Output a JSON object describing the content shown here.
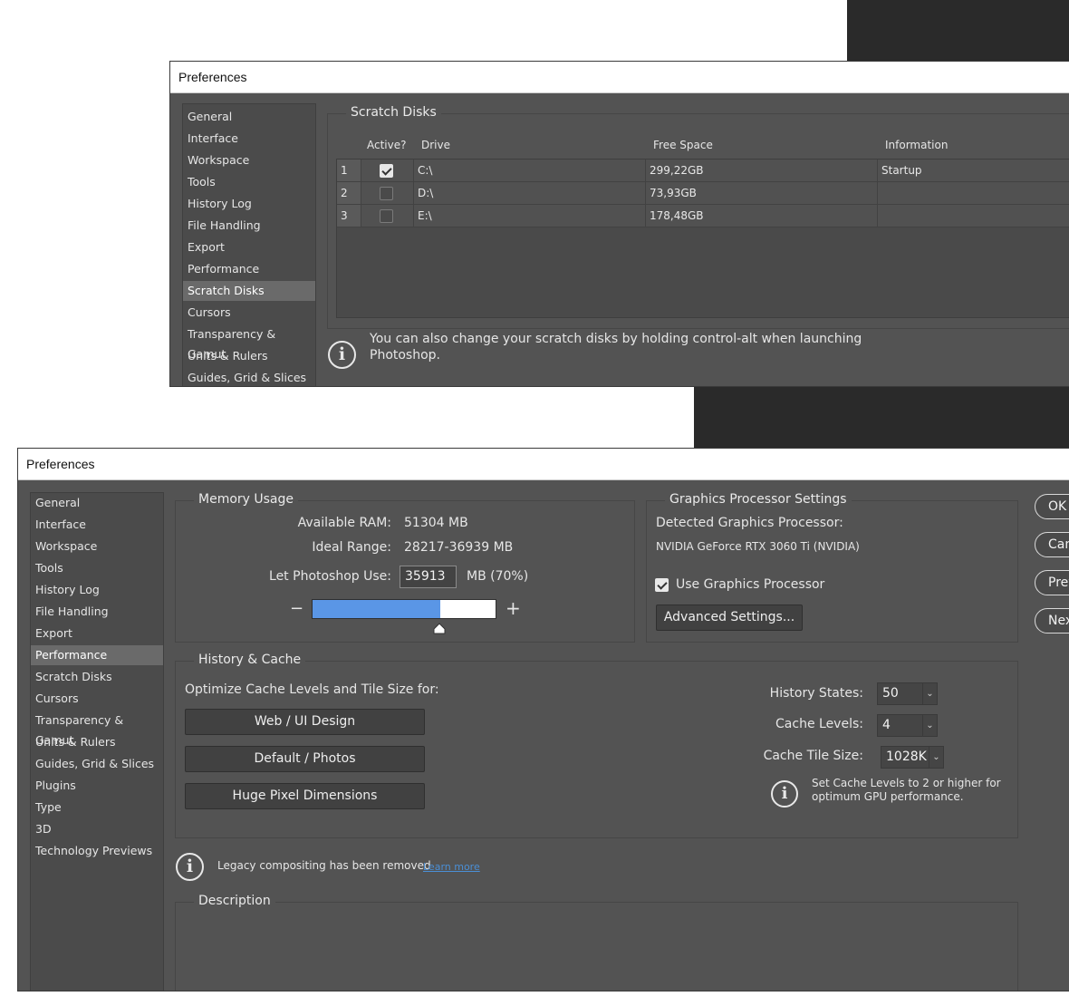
{
  "top": {
    "title": "Preferences",
    "sidebar": [
      "General",
      "Interface",
      "Workspace",
      "Tools",
      "History Log",
      "File Handling",
      "Export",
      "Performance",
      "Scratch Disks",
      "Cursors",
      "Transparency & Gamut",
      "Units & Rulers",
      "Guides, Grid & Slices"
    ],
    "active_index": 8,
    "section_title": "Scratch Disks",
    "columns": {
      "active": "Active?",
      "drive": "Drive",
      "free": "Free Space",
      "info": "Information"
    },
    "rows": [
      {
        "num": "1",
        "active": true,
        "drive": "C:\\",
        "free": "299,22GB",
        "info": "Startup"
      },
      {
        "num": "2",
        "active": false,
        "drive": "D:\\",
        "free": "73,93GB",
        "info": ""
      },
      {
        "num": "3",
        "active": false,
        "drive": "E:\\",
        "free": "178,48GB",
        "info": ""
      }
    ],
    "info_text_line1": "You can also change your scratch disks by holding control-alt when launching",
    "info_text_line2": "Photoshop."
  },
  "bottom": {
    "title": "Preferences",
    "sidebar": [
      "General",
      "Interface",
      "Workspace",
      "Tools",
      "History Log",
      "File Handling",
      "Export",
      "Performance",
      "Scratch Disks",
      "Cursors",
      "Transparency & Gamut",
      "Units & Rulers",
      "Guides, Grid & Slices",
      "Plugins",
      "Type",
      "3D",
      "Technology Previews"
    ],
    "active_index": 7,
    "memory": {
      "title": "Memory Usage",
      "available_label": "Available RAM:",
      "available_value": "51304 MB",
      "ideal_label": "Ideal Range:",
      "ideal_value": "28217-36939 MB",
      "use_label": "Let Photoshop Use:",
      "use_value": "35913",
      "use_suffix": "MB (70%)",
      "minus": "−",
      "plus": "+",
      "slider_fraction": 0.7
    },
    "gpu": {
      "title": "Graphics Processor Settings",
      "detected_label": "Detected Graphics Processor:",
      "detected_value": "NVIDIA GeForce RTX 3060 Ti (NVIDIA)",
      "use_label": "Use Graphics Processor",
      "use_checked": true,
      "advanced": "Advanced Settings..."
    },
    "history": {
      "title": "History & Cache",
      "optimize_label": "Optimize Cache Levels and Tile Size for:",
      "btn_web": "Web / UI Design",
      "btn_default": "Default / Photos",
      "btn_huge": "Huge Pixel Dimensions",
      "states_label": "History States:",
      "states_value": "50",
      "levels_label": "Cache Levels:",
      "levels_value": "4",
      "tile_label": "Cache Tile Size:",
      "tile_value": "1028K",
      "note_line1": "Set Cache Levels to 2 or higher for",
      "note_line2": "optimum GPU performance."
    },
    "legacy_text": "Legacy compositing has been removed",
    "learn_more": "Learn more",
    "description_title": "Description",
    "buttons": [
      "OK",
      "Cancel",
      "Prev",
      "Next"
    ],
    "link_color": "#4a8fd6",
    "slider_color": "#5a96e6"
  }
}
